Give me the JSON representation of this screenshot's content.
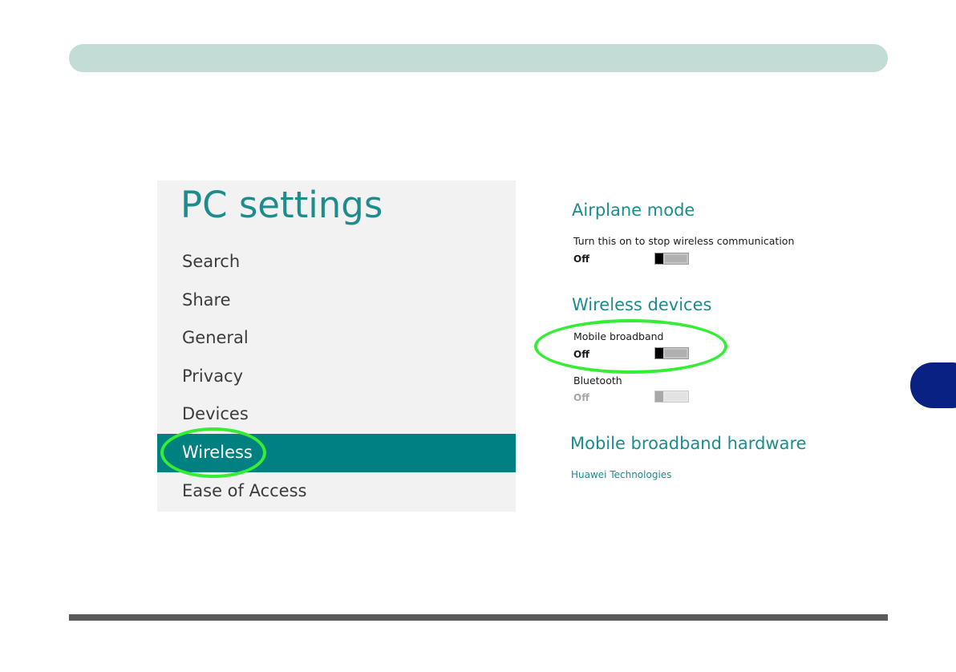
{
  "nav": {
    "title": "PC settings",
    "items": [
      {
        "label": "Search",
        "active": false
      },
      {
        "label": "Share",
        "active": false
      },
      {
        "label": "General",
        "active": false
      },
      {
        "label": "Privacy",
        "active": false
      },
      {
        "label": "Devices",
        "active": false
      },
      {
        "label": "Wireless",
        "active": true
      },
      {
        "label": "Ease of Access",
        "active": false
      }
    ]
  },
  "airplane_mode": {
    "heading": "Airplane mode",
    "description": "Turn this on to stop wireless communication",
    "state": "Off"
  },
  "wireless_devices": {
    "heading": "Wireless devices",
    "mobile_broadband": {
      "label": "Mobile broadband",
      "state": "Off"
    },
    "bluetooth": {
      "label": "Bluetooth",
      "state": "Off",
      "disabled": true
    }
  },
  "hardware": {
    "heading": "Mobile broadband hardware",
    "vendor_link": "Huawei Technologies"
  },
  "colors": {
    "accent": "#1c8c8c",
    "selected_item_bg": "#008080",
    "annotation": "#33ee33",
    "header_bar": "#c3dcd6",
    "side_tab": "#0a2184"
  }
}
